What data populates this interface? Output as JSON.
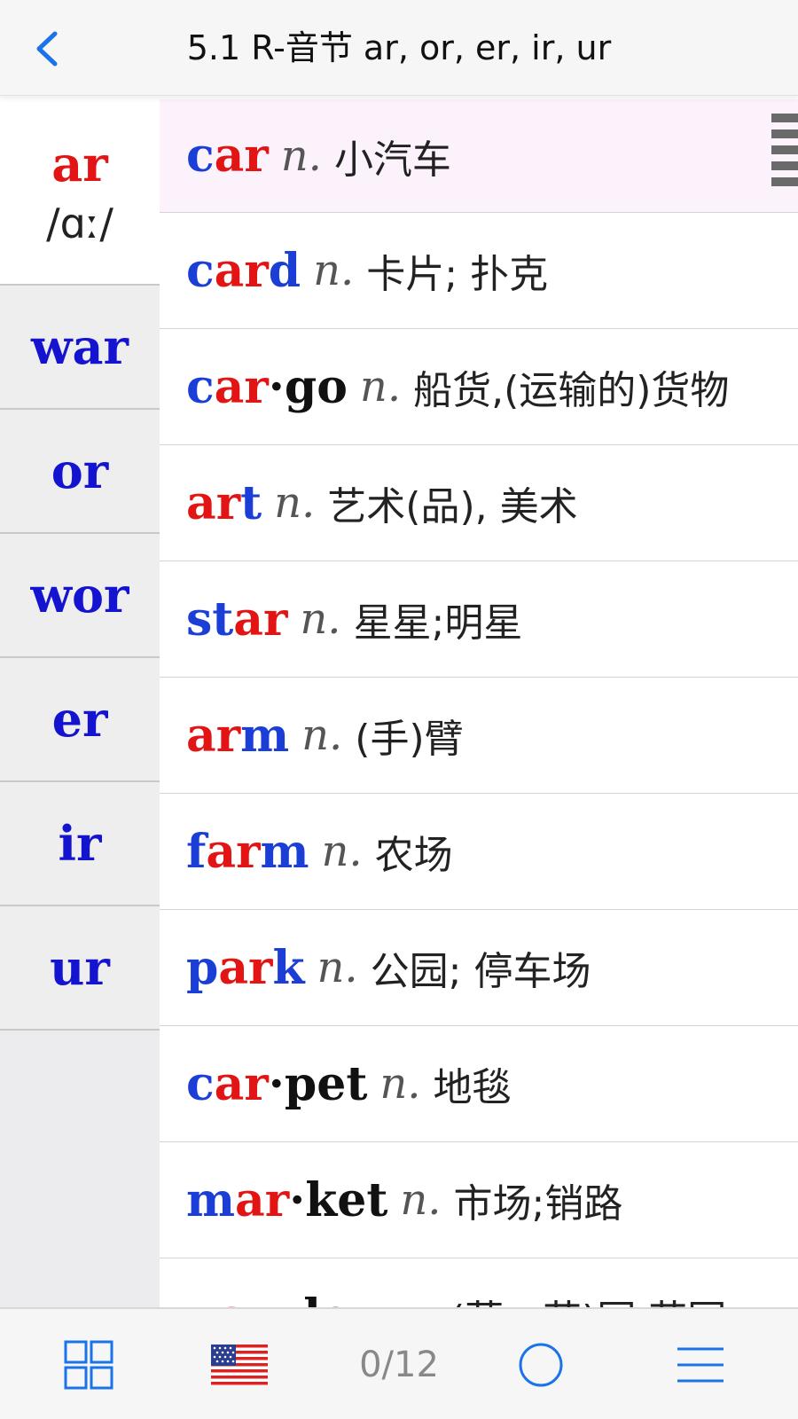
{
  "header": {
    "title": "5.1 R-音节 ar, or, er, ir, ur"
  },
  "sidebar": {
    "items": [
      {
        "label": "ar",
        "ipa": "/ɑː/",
        "active": true
      },
      {
        "label": "war"
      },
      {
        "label": "or"
      },
      {
        "label": "wor"
      },
      {
        "label": "er"
      },
      {
        "label": "ir"
      },
      {
        "label": "ur"
      }
    ]
  },
  "words": [
    {
      "parts": [
        {
          "t": "c",
          "c": "blue"
        },
        {
          "t": "ar",
          "c": "red"
        }
      ],
      "pos": "n.",
      "meaning": "小汽车",
      "highlight": true
    },
    {
      "parts": [
        {
          "t": "c",
          "c": "blue"
        },
        {
          "t": "ar",
          "c": "red"
        },
        {
          "t": "d",
          "c": "blue"
        }
      ],
      "pos": "n.",
      "meaning": "卡片; 扑克"
    },
    {
      "parts": [
        {
          "t": "c",
          "c": "blue"
        },
        {
          "t": "ar",
          "c": "red"
        },
        {
          "t": "·go",
          "c": "black"
        }
      ],
      "pos": "n.",
      "meaning": "船货,(运输的)货物"
    },
    {
      "parts": [
        {
          "t": "ar",
          "c": "red"
        },
        {
          "t": "t",
          "c": "blue"
        }
      ],
      "pos": "n.",
      "meaning": "艺术(品), 美术"
    },
    {
      "parts": [
        {
          "t": "st",
          "c": "blue"
        },
        {
          "t": "ar",
          "c": "red"
        }
      ],
      "pos": "n.",
      "meaning": "星星;明星"
    },
    {
      "parts": [
        {
          "t": "ar",
          "c": "red"
        },
        {
          "t": "m",
          "c": "blue"
        }
      ],
      "pos": "n.",
      "meaning": "(手)臂"
    },
    {
      "parts": [
        {
          "t": "f",
          "c": "blue"
        },
        {
          "t": "ar",
          "c": "red"
        },
        {
          "t": "m",
          "c": "blue"
        }
      ],
      "pos": "n.",
      "meaning": "农场"
    },
    {
      "parts": [
        {
          "t": "p",
          "c": "blue"
        },
        {
          "t": "ar",
          "c": "red"
        },
        {
          "t": "k",
          "c": "blue"
        }
      ],
      "pos": "n.",
      "meaning": "公园; 停车场"
    },
    {
      "parts": [
        {
          "t": "c",
          "c": "blue"
        },
        {
          "t": "ar",
          "c": "red"
        },
        {
          "t": "·pet",
          "c": "black"
        }
      ],
      "pos": "n.",
      "meaning": "地毯"
    },
    {
      "parts": [
        {
          "t": "m",
          "c": "blue"
        },
        {
          "t": "ar",
          "c": "red"
        },
        {
          "t": "·ket",
          "c": "black"
        }
      ],
      "pos": "n.",
      "meaning": "市场;销路"
    },
    {
      "parts": [
        {
          "t": "g",
          "c": "blue"
        },
        {
          "t": "ar",
          "c": "red"
        },
        {
          "t": "·den",
          "c": "black"
        }
      ],
      "pos": "n.",
      "meaning": "(菜，花)园,花园"
    }
  ],
  "toolbar": {
    "grid_icon": "grid-icon",
    "flag_icon": "us-flag-icon",
    "progress": "0/12",
    "circle_icon": "circle-icon",
    "menu_icon": "menu-icon"
  },
  "colors": {
    "blue": "#1b3ed6",
    "red": "#e21414",
    "accent": "#1a73e8"
  }
}
